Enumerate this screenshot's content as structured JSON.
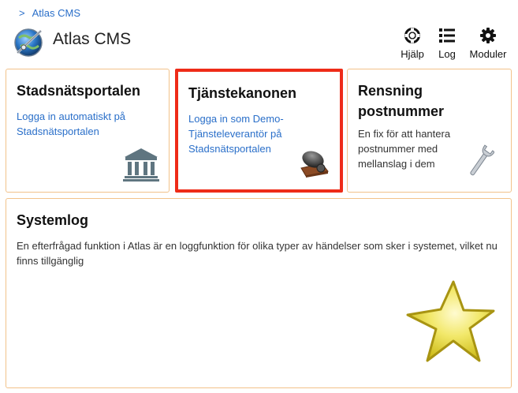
{
  "breadcrumb": {
    "separator": ">",
    "items": [
      "Atlas CMS"
    ]
  },
  "header": {
    "title": "Atlas CMS"
  },
  "toolbar": {
    "help_label": "Hjälp",
    "log_label": "Log",
    "modules_label": "Moduler"
  },
  "cards": [
    {
      "title": "Stadsnätsportalen",
      "link_text": "Logga in automatiskt på Stadsnätsportalen",
      "icon": "bank-icon"
    },
    {
      "title": "Tjänstekanonen",
      "link_text": "Logga in som Demo-Tjänsteleverantör på Stadsnätsportalen",
      "icon": "cannon-icon",
      "highlighted": true
    },
    {
      "title": "Rensning postnummer",
      "text": "En fix för att hantera postnummer med mellanslag i dem",
      "icon": "wrench-icon"
    },
    {
      "title": "Systemlog",
      "text": "En efterfrågad funktion i Atlas är en loggfunktion för olika typer av händelser som sker i systemet, vilket nu finns tillgänglig",
      "icon": "star-icon"
    }
  ],
  "colors": {
    "link": "#2a6fc9",
    "card_border": "#f2c28a",
    "highlight_border": "#ee2b18"
  }
}
